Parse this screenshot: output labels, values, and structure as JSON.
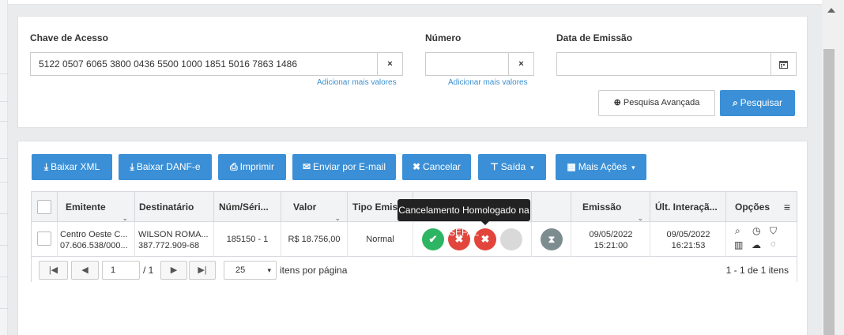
{
  "search": {
    "chave_label": "Chave de Acesso",
    "chave_value": "5122 0507 6065 3800 0436 5500 1000 1851 5016 7863 1486",
    "numero_label": "Número",
    "numero_value": "",
    "data_label": "Data de Emissão",
    "data_value": "",
    "add_more": "Adicionar mais valores",
    "clear_icon": "×",
    "advanced_label": "Pesquisa Avançada",
    "search_label": "Pesquisar"
  },
  "toolbar": {
    "baixar_xml": "Baixar XML",
    "baixar_danfe": "Baixar DANF-e",
    "imprimir": "Imprimir",
    "enviar_email": "Enviar por E-mail",
    "cancelar": "Cancelar",
    "saida": "Saída",
    "mais_acoes": "Mais Ações"
  },
  "grid": {
    "columns": [
      "Emitente",
      "Destinatário",
      "Núm/Séri...",
      "Valor",
      "Tipo Emis",
      "Emissão",
      "Últ. Interaçã...",
      "Opções"
    ],
    "row": {
      "emitente_name": "Centro Oeste C...",
      "emitente_doc": "07.606.538/000...",
      "destinatario_name": "WILSON ROMA...",
      "destinatario_doc": "387.772.909-68",
      "numero_serie": "185150 - 1",
      "valor": "R$ 18.756,00",
      "tipo": "Normal",
      "emissao_date": "09/05/2022",
      "emissao_time": "15:21:00",
      "ultima_date": "09/05/2022",
      "ultima_time": "16:21:53"
    },
    "status_colors": {
      "green": "#2eb563",
      "red": "#e2453c",
      "gray": "#d9d9d9",
      "hourglass": "#7d8c8f"
    }
  },
  "tooltip": "Cancelamento Homologado na SEFAZ",
  "pager": {
    "page": "1",
    "total_pages": "/ 1",
    "per_page": "25",
    "per_page_label": "itens por página",
    "summary": "1 - 1 de 1 itens"
  },
  "icons": {
    "first": "|◀",
    "prev": "◀",
    "next": "▶",
    "last": "▶|",
    "sort": "⌄"
  }
}
